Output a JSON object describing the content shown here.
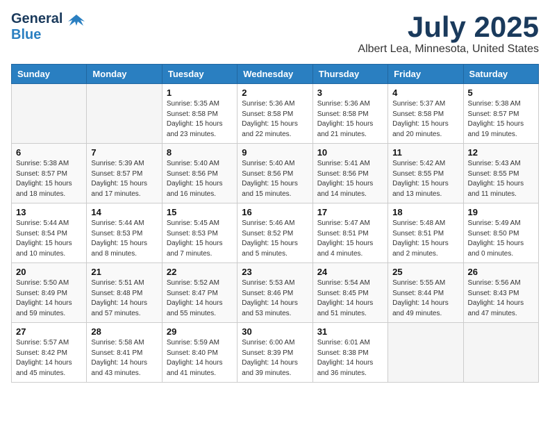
{
  "header": {
    "logo_general": "General",
    "logo_blue": "Blue",
    "title": "July 2025",
    "subtitle": "Albert Lea, Minnesota, United States"
  },
  "calendar": {
    "days_of_week": [
      "Sunday",
      "Monday",
      "Tuesday",
      "Wednesday",
      "Thursday",
      "Friday",
      "Saturday"
    ],
    "weeks": [
      [
        {
          "day": "",
          "info": ""
        },
        {
          "day": "",
          "info": ""
        },
        {
          "day": "1",
          "info": "Sunrise: 5:35 AM\nSunset: 8:58 PM\nDaylight: 15 hours\nand 23 minutes."
        },
        {
          "day": "2",
          "info": "Sunrise: 5:36 AM\nSunset: 8:58 PM\nDaylight: 15 hours\nand 22 minutes."
        },
        {
          "day": "3",
          "info": "Sunrise: 5:36 AM\nSunset: 8:58 PM\nDaylight: 15 hours\nand 21 minutes."
        },
        {
          "day": "4",
          "info": "Sunrise: 5:37 AM\nSunset: 8:58 PM\nDaylight: 15 hours\nand 20 minutes."
        },
        {
          "day": "5",
          "info": "Sunrise: 5:38 AM\nSunset: 8:57 PM\nDaylight: 15 hours\nand 19 minutes."
        }
      ],
      [
        {
          "day": "6",
          "info": "Sunrise: 5:38 AM\nSunset: 8:57 PM\nDaylight: 15 hours\nand 18 minutes."
        },
        {
          "day": "7",
          "info": "Sunrise: 5:39 AM\nSunset: 8:57 PM\nDaylight: 15 hours\nand 17 minutes."
        },
        {
          "day": "8",
          "info": "Sunrise: 5:40 AM\nSunset: 8:56 PM\nDaylight: 15 hours\nand 16 minutes."
        },
        {
          "day": "9",
          "info": "Sunrise: 5:40 AM\nSunset: 8:56 PM\nDaylight: 15 hours\nand 15 minutes."
        },
        {
          "day": "10",
          "info": "Sunrise: 5:41 AM\nSunset: 8:56 PM\nDaylight: 15 hours\nand 14 minutes."
        },
        {
          "day": "11",
          "info": "Sunrise: 5:42 AM\nSunset: 8:55 PM\nDaylight: 15 hours\nand 13 minutes."
        },
        {
          "day": "12",
          "info": "Sunrise: 5:43 AM\nSunset: 8:55 PM\nDaylight: 15 hours\nand 11 minutes."
        }
      ],
      [
        {
          "day": "13",
          "info": "Sunrise: 5:44 AM\nSunset: 8:54 PM\nDaylight: 15 hours\nand 10 minutes."
        },
        {
          "day": "14",
          "info": "Sunrise: 5:44 AM\nSunset: 8:53 PM\nDaylight: 15 hours\nand 8 minutes."
        },
        {
          "day": "15",
          "info": "Sunrise: 5:45 AM\nSunset: 8:53 PM\nDaylight: 15 hours\nand 7 minutes."
        },
        {
          "day": "16",
          "info": "Sunrise: 5:46 AM\nSunset: 8:52 PM\nDaylight: 15 hours\nand 5 minutes."
        },
        {
          "day": "17",
          "info": "Sunrise: 5:47 AM\nSunset: 8:51 PM\nDaylight: 15 hours\nand 4 minutes."
        },
        {
          "day": "18",
          "info": "Sunrise: 5:48 AM\nSunset: 8:51 PM\nDaylight: 15 hours\nand 2 minutes."
        },
        {
          "day": "19",
          "info": "Sunrise: 5:49 AM\nSunset: 8:50 PM\nDaylight: 15 hours\nand 0 minutes."
        }
      ],
      [
        {
          "day": "20",
          "info": "Sunrise: 5:50 AM\nSunset: 8:49 PM\nDaylight: 14 hours\nand 59 minutes."
        },
        {
          "day": "21",
          "info": "Sunrise: 5:51 AM\nSunset: 8:48 PM\nDaylight: 14 hours\nand 57 minutes."
        },
        {
          "day": "22",
          "info": "Sunrise: 5:52 AM\nSunset: 8:47 PM\nDaylight: 14 hours\nand 55 minutes."
        },
        {
          "day": "23",
          "info": "Sunrise: 5:53 AM\nSunset: 8:46 PM\nDaylight: 14 hours\nand 53 minutes."
        },
        {
          "day": "24",
          "info": "Sunrise: 5:54 AM\nSunset: 8:45 PM\nDaylight: 14 hours\nand 51 minutes."
        },
        {
          "day": "25",
          "info": "Sunrise: 5:55 AM\nSunset: 8:44 PM\nDaylight: 14 hours\nand 49 minutes."
        },
        {
          "day": "26",
          "info": "Sunrise: 5:56 AM\nSunset: 8:43 PM\nDaylight: 14 hours\nand 47 minutes."
        }
      ],
      [
        {
          "day": "27",
          "info": "Sunrise: 5:57 AM\nSunset: 8:42 PM\nDaylight: 14 hours\nand 45 minutes."
        },
        {
          "day": "28",
          "info": "Sunrise: 5:58 AM\nSunset: 8:41 PM\nDaylight: 14 hours\nand 43 minutes."
        },
        {
          "day": "29",
          "info": "Sunrise: 5:59 AM\nSunset: 8:40 PM\nDaylight: 14 hours\nand 41 minutes."
        },
        {
          "day": "30",
          "info": "Sunrise: 6:00 AM\nSunset: 8:39 PM\nDaylight: 14 hours\nand 39 minutes."
        },
        {
          "day": "31",
          "info": "Sunrise: 6:01 AM\nSunset: 8:38 PM\nDaylight: 14 hours\nand 36 minutes."
        },
        {
          "day": "",
          "info": ""
        },
        {
          "day": "",
          "info": ""
        }
      ]
    ]
  }
}
